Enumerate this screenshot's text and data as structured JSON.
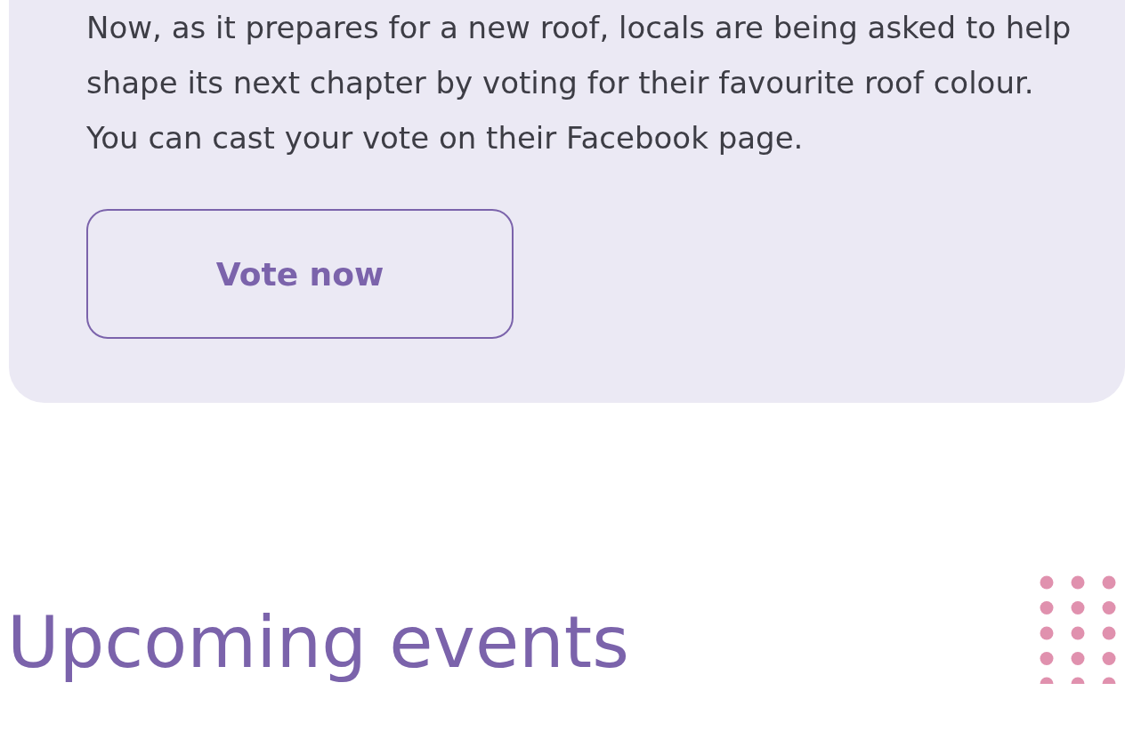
{
  "card": {
    "paragraph": "Now, as it prepares for a new roof, locals are being asked to help shape its next chapter by voting for their favourite roof colour. You can cast your vote on their Facebook page.",
    "button": {
      "label": "Vote now"
    }
  },
  "section": {
    "heading": "Upcoming events"
  }
}
